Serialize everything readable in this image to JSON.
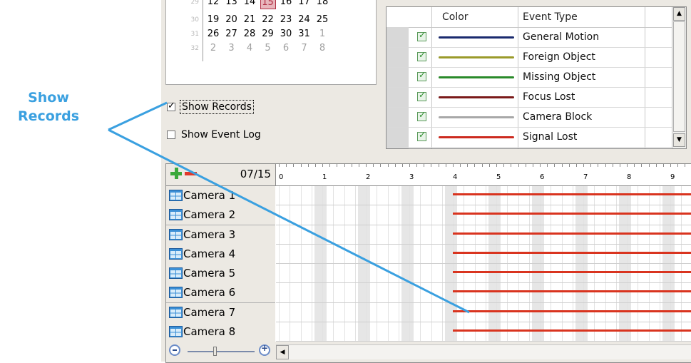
{
  "callout": {
    "line1": "Show",
    "line2": "Records"
  },
  "calendar": {
    "week_numbers": [
      "29",
      "30",
      "31",
      "32"
    ],
    "weeks": [
      [
        {
          "d": "12"
        },
        {
          "d": "13"
        },
        {
          "d": "14"
        },
        {
          "d": "15",
          "today": true
        },
        {
          "d": "16"
        },
        {
          "d": "17"
        },
        {
          "d": "18"
        }
      ],
      [
        {
          "d": "19"
        },
        {
          "d": "20"
        },
        {
          "d": "21"
        },
        {
          "d": "22"
        },
        {
          "d": "23"
        },
        {
          "d": "24"
        },
        {
          "d": "25"
        }
      ],
      [
        {
          "d": "26"
        },
        {
          "d": "27"
        },
        {
          "d": "28"
        },
        {
          "d": "29"
        },
        {
          "d": "30"
        },
        {
          "d": "31"
        },
        {
          "d": "1",
          "other": true
        }
      ],
      [
        {
          "d": "2",
          "other": true
        },
        {
          "d": "3",
          "other": true
        },
        {
          "d": "4",
          "other": true
        },
        {
          "d": "5",
          "other": true
        },
        {
          "d": "6",
          "other": true
        },
        {
          "d": "7",
          "other": true
        },
        {
          "d": "8",
          "other": true
        }
      ]
    ]
  },
  "options": {
    "show_records": {
      "label": "Show Records",
      "checked": true
    },
    "show_event_log": {
      "label": "Show Event Log",
      "checked": false
    }
  },
  "event_table": {
    "headers": {
      "color": "Color",
      "event_type": "Event Type"
    },
    "rows": [
      {
        "name": "General Motion",
        "color": "#1a2a6e",
        "checked": true
      },
      {
        "name": "Foreign Object",
        "color": "#9a9a2a",
        "checked": true
      },
      {
        "name": "Missing Object",
        "color": "#2a8a2a",
        "checked": true
      },
      {
        "name": "Focus Lost",
        "color": "#7a1a1a",
        "checked": true
      },
      {
        "name": "Camera Block",
        "color": "#a8a8a8",
        "checked": true
      },
      {
        "name": "Signal Lost",
        "color": "#cc2a1f",
        "checked": true
      }
    ],
    "scroll_up": "▲",
    "scroll_down": "▼"
  },
  "timeline": {
    "date": "07/15",
    "hours": [
      "0",
      "1",
      "2",
      "3",
      "4",
      "5",
      "6",
      "7",
      "8",
      "9"
    ],
    "record_color": "#d9341f",
    "record_start_hour": 4,
    "cameras": [
      "Camera 1",
      "Camera 2",
      "Camera 3",
      "Camera 4",
      "Camera 5",
      "Camera 6",
      "Camera 7",
      "Camera 8"
    ],
    "scroll_left": "◀"
  }
}
